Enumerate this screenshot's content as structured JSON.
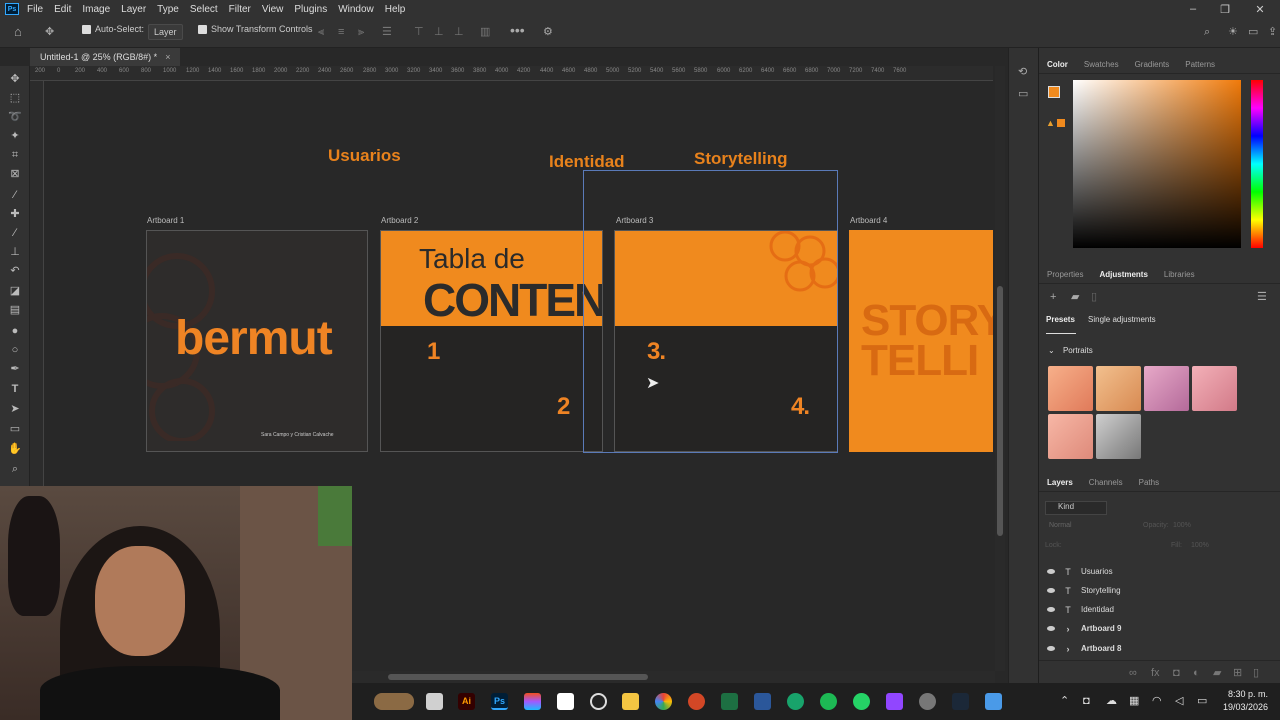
{
  "app": {
    "logo": "Ps"
  },
  "menu": [
    "File",
    "Edit",
    "Image",
    "Layer",
    "Type",
    "Select",
    "Filter",
    "View",
    "Plugins",
    "Window",
    "Help"
  ],
  "options": {
    "auto_select_label": "Auto-Select:",
    "auto_select_value": "Layer",
    "transform_label": "Show Transform Controls"
  },
  "document_tab": "Untitled-1 @ 25% (RGB/8#) *",
  "ruler_ticks": [
    "200",
    "0",
    "200",
    "400",
    "600",
    "800",
    "1000",
    "1200",
    "1400",
    "1600",
    "1800",
    "2000",
    "2200",
    "2400",
    "2600",
    "2800",
    "3000",
    "3200",
    "3400",
    "3600",
    "3800",
    "4000",
    "4200",
    "4400",
    "4600",
    "4800",
    "5000",
    "5200",
    "5400",
    "5600",
    "5800",
    "6000",
    "6200",
    "6400",
    "6600",
    "6800",
    "7000",
    "7200",
    "7400",
    "7600"
  ],
  "canvas": {
    "headings": {
      "usuarios": "Usuarios",
      "identidad": "Identidad",
      "storytelling": "Storytelling"
    },
    "artboards": [
      {
        "label": "Artboard 1",
        "title": "bermut",
        "credit": "Sara Campo y Cristian Calvache"
      },
      {
        "label": "Artboard 2",
        "line1": "Tabla de",
        "line2": "CONTENIDOS",
        "n1": "1",
        "n2": "2"
      },
      {
        "label": "Artboard 3",
        "n3": "3.",
        "n4": "4."
      },
      {
        "label": "Artboard 4",
        "line1": "STORY",
        "line2": "TELLI"
      }
    ]
  },
  "panels": {
    "color_tabs": [
      "Color",
      "Swatches",
      "Gradients",
      "Patterns"
    ],
    "adjust_tabs": [
      "Properties",
      "Adjustments",
      "Libraries"
    ],
    "presets_tabs": [
      "Presets",
      "Single adjustments"
    ],
    "portraits_label": "Portraits",
    "layers_tabs": [
      "Layers",
      "Channels",
      "Paths"
    ],
    "layers_filter": "Kind",
    "blend_mode": "Normal",
    "opacity_label": "Opacity:",
    "opacity_value": "100%",
    "lock_label": "Lock:",
    "fill_label": "Fill:",
    "fill_value": "100%",
    "layers": [
      {
        "type": "T",
        "name": "Usuarios",
        "bold": false
      },
      {
        "type": "T",
        "name": "Storytelling",
        "bold": false
      },
      {
        "type": "T",
        "name": "Identidad",
        "bold": false
      },
      {
        "type": "›",
        "name": "Artboard 9",
        "bold": true
      },
      {
        "type": "›",
        "name": "Artboard 8",
        "bold": true
      }
    ]
  },
  "colors": {
    "accent": "#e8821c",
    "foreground": "#f08a1e",
    "canvas": "#282828"
  },
  "clock": {
    "time": "8:30 p. m.",
    "date": "19/03/2026"
  }
}
